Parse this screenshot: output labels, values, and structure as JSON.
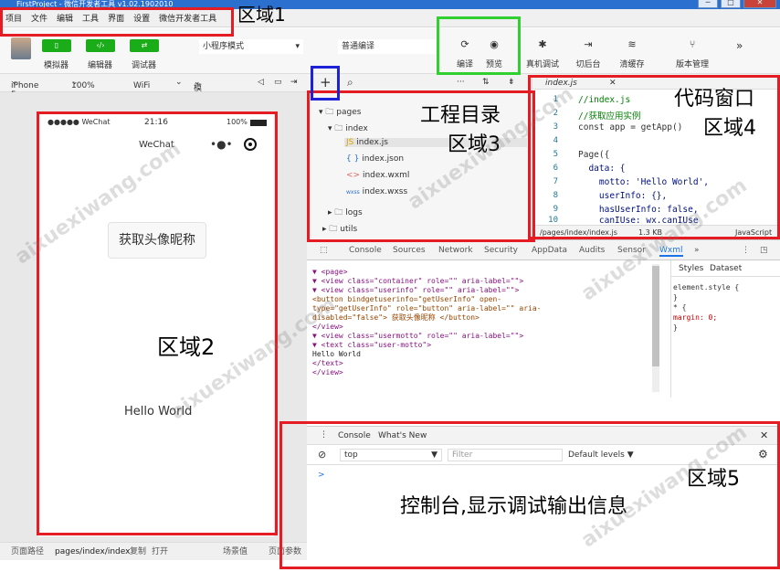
{
  "window": {
    "title": "FirstProject - 微信开发者工具 v1.02.1902010",
    "buttons": [
      "─",
      "□",
      "✕"
    ]
  },
  "menu": [
    "项目",
    "文件",
    "编辑",
    "工具",
    "界面",
    "设置",
    "微信开发者工具"
  ],
  "toolbar": {
    "left_buttons": [
      {
        "label": "模拟器",
        "icon": "phone-icon"
      },
      {
        "label": "编辑器",
        "icon": "code-icon"
      },
      {
        "label": "调试器",
        "icon": "debug-icon"
      }
    ],
    "mode_select": "小程序模式",
    "compile_select": "普通编译",
    "right_buttons": [
      {
        "label": "编译",
        "glyph": "⟳"
      },
      {
        "label": "预览",
        "glyph": "◉"
      },
      {
        "label": "真机调试",
        "glyph": "✱"
      },
      {
        "label": "切后台",
        "glyph": "⇥"
      },
      {
        "label": "清缓存",
        "glyph": "≋"
      },
      {
        "label": "版本管理",
        "glyph": "⑂"
      }
    ],
    "more": "»"
  },
  "devbar": {
    "device": "iPhone 5",
    "zoom": "100%",
    "network": "WiFi",
    "simulate": "模拟操作",
    "plus": "+",
    "search": "⌕",
    "dots": "···",
    "file_tab": "index.js",
    "close": "✕"
  },
  "phone": {
    "signal": "●●●●● WeChat",
    "time": "21:16",
    "battery": "100%",
    "nav_title": "WeChat",
    "button": "获取头像昵称",
    "motto": "Hello World"
  },
  "status": {
    "path_label": "页面路径",
    "path": "pages/index/index",
    "copy": "复制",
    "open": "打开",
    "scene": "场景值",
    "params": "页面参数"
  },
  "explorer": {
    "items": [
      {
        "label": "pages",
        "icon": "▾ 🗀"
      },
      {
        "label": "index",
        "icon": "▾ 🗀"
      },
      {
        "label": "index.js",
        "icon": "JS"
      },
      {
        "label": "index.json",
        "icon": "{ }"
      },
      {
        "label": "index.wxml",
        "icon": "<>"
      },
      {
        "label": "index.wxss",
        "icon": "wxss"
      },
      {
        "label": "logs",
        "icon": "▸ 🗀"
      },
      {
        "label": "utils",
        "icon": "▸ 🗀"
      }
    ]
  },
  "editor": {
    "lines": [
      {
        "n": "1",
        "t": "//index.js"
      },
      {
        "n": "2",
        "t": "//获取应用实例"
      },
      {
        "n": "3",
        "t": "const app = getApp()"
      },
      {
        "n": "4",
        "t": ""
      },
      {
        "n": "5",
        "t": "Page({"
      },
      {
        "n": "6",
        "t": "  data: {"
      },
      {
        "n": "7",
        "t": "    motto: 'Hello World',"
      },
      {
        "n": "8",
        "t": "    userInfo: {},"
      },
      {
        "n": "9",
        "t": "    hasUserInfo: false,"
      },
      {
        "n": "10",
        "t": "    canIUse: wx.canIUse"
      }
    ],
    "status_path": "/pages/index/index.js",
    "status_size": "1.3 KB",
    "status_lang": "JavaScript"
  },
  "devtools": {
    "tabs": [
      "Console",
      "Sources",
      "Network",
      "Security",
      "AppData",
      "Audits",
      "Sensor",
      "Wxml",
      "»"
    ],
    "styles_tabs": [
      "Styles",
      "Dataset"
    ],
    "styles": [
      "element.style {",
      "}",
      "* {",
      "  margin: 0;",
      "}"
    ],
    "wxml": [
      "▼ <page>",
      "  ▼ <view class=\"container\" role=\"\" aria-label=\"\">",
      "    ▼ <view class=\"userinfo\" role=\"\" aria-label=\"\">",
      "        <button bindgetuserinfo=\"getUserInfo\" open-",
      "        type=\"getUserInfo\" role=\"button\" aria-label=\"\" aria-",
      "        disabled=\"false\"> 获取头像昵称 </button>",
      "      </view>",
      "    ▼ <view class=\"usermotto\" role=\"\" aria-label=\"\">",
      "      ▼ <text class=\"user-motto\">",
      "        Hello World",
      "        </text>",
      "      </view>"
    ]
  },
  "console": {
    "tabs": [
      "Console",
      "What's New"
    ],
    "context": "top",
    "filter": "Filter",
    "levels": "Default levels",
    "prompt": ">",
    "close": "✕"
  },
  "annotations": {
    "a1": "区域1",
    "a2": "区域2",
    "a3a": "工程目录",
    "a3b": "区域3",
    "a4a": "代码窗口",
    "a4b": "区域4",
    "a5": "区域5",
    "a5desc": "控制台,显示调试输出信息"
  },
  "watermark": "aixuexiwang.com",
  "colors": {
    "annotation_red": "#e51c23",
    "highlight_green": "#2fd02f",
    "highlight_blue": "#1d22d6",
    "wechat_green": "#1aad19",
    "titlebar": "#2b6fcf"
  }
}
